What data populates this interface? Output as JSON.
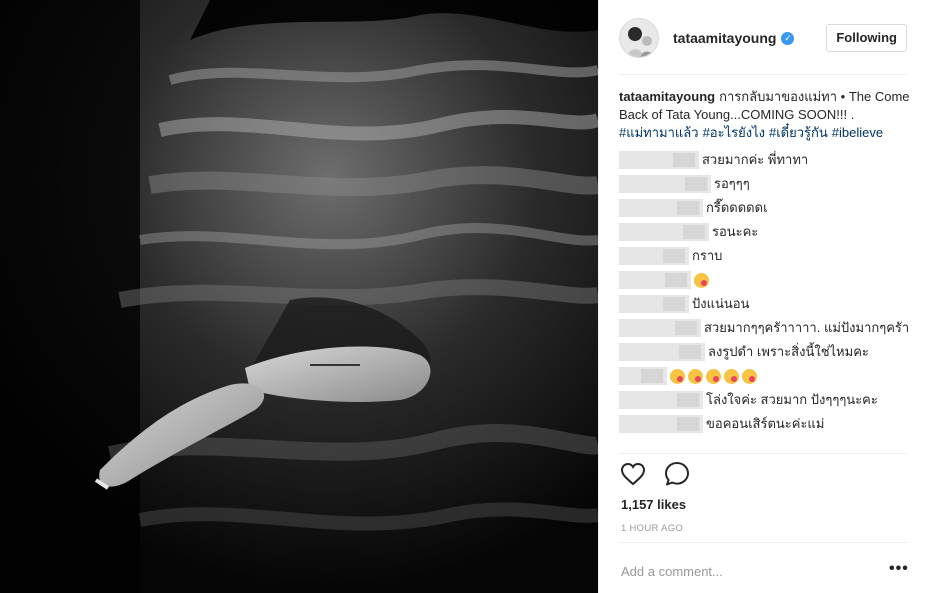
{
  "post": {
    "username": "tataamitayoung",
    "follow_label": "Following",
    "caption": {
      "username": "tataamitayoung",
      "text": "การกลับมาของแม่ทา • The Come Back of Tata Young...COMING SOON!!! .",
      "hashtags": [
        "#แม่ทามาแล้ว",
        "#อะไรยังไง",
        "#เดี๋ยวรู้กัน",
        "#ibelieve"
      ]
    },
    "comments": [
      {
        "text": "สวยมากค่ะ พี่ทาทา"
      },
      {
        "text": "รอๆๆๆ"
      },
      {
        "text": "กรี๊ดดดดดเ"
      },
      {
        "text": "รอนะคะ"
      },
      {
        "text": "กราบ"
      },
      {
        "text": ""
      },
      {
        "text": "ปังแน่นอน"
      },
      {
        "text": "สวยมากๆๆครัาาาาา. แม่ปังมากๆครัา"
      },
      {
        "text": "ลงรูปดำ เพราะสิ่งนี้ใช่ไหมคะ"
      },
      {
        "text": ""
      },
      {
        "text": "โล่งใจค่ะ สวยมาก ปังๆๆๆนะคะ"
      },
      {
        "text": "ขอคอนเสิร์ตนะค่ะแม่"
      }
    ],
    "likes": "1,157 likes",
    "time": "1 HOUR AGO",
    "comment_placeholder": "Add a comment...",
    "more_label": "•••"
  },
  "icons": {
    "like": "heart-icon",
    "comment": "comment-bubble-icon",
    "verified": "verified-badge-icon",
    "more": "more-options-icon",
    "emoji": "kissing-face-emoji"
  },
  "colors": {
    "link": "#003569",
    "verified": "#3897f0",
    "border": "#efefef"
  }
}
